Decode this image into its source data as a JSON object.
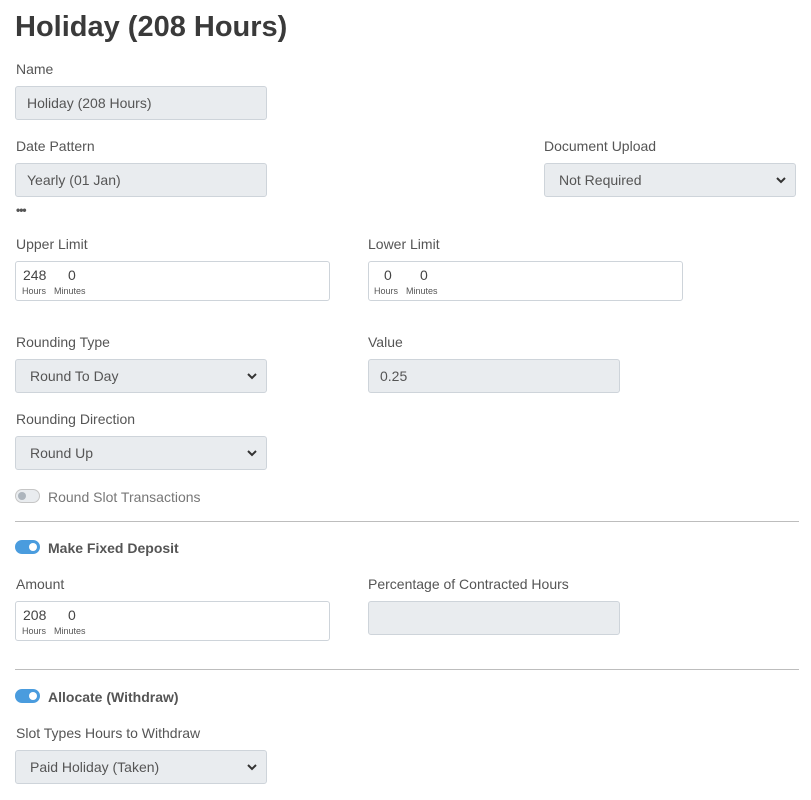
{
  "page": {
    "title": "Holiday (208 Hours)"
  },
  "name": {
    "label": "Name",
    "value": "Holiday (208 Hours)"
  },
  "date_pattern": {
    "label": "Date Pattern",
    "value": "Yearly (01 Jan)",
    "more": "•••"
  },
  "document_upload": {
    "label": "Document Upload",
    "selected": "Not Required"
  },
  "upper_limit": {
    "label": "Upper Limit",
    "hours": "248",
    "minutes": "0",
    "hours_unit": "Hours",
    "minutes_unit": "Minutes"
  },
  "lower_limit": {
    "label": "Lower Limit",
    "hours": "0",
    "minutes": "0",
    "hours_unit": "Hours",
    "minutes_unit": "Minutes"
  },
  "rounding_type": {
    "label": "Rounding Type",
    "selected": "Round To Day"
  },
  "value": {
    "label": "Value",
    "value": "0.25"
  },
  "rounding_direction": {
    "label": "Rounding Direction",
    "selected": "Round Up"
  },
  "round_slot": {
    "label": "Round Slot Transactions",
    "enabled": false
  },
  "fixed_deposit": {
    "label": "Make Fixed Deposit",
    "enabled": true
  },
  "amount": {
    "label": "Amount",
    "hours": "208",
    "minutes": "0",
    "hours_unit": "Hours",
    "minutes_unit": "Minutes"
  },
  "percentage": {
    "label": "Percentage of Contracted Hours",
    "value": ""
  },
  "allocate": {
    "label": "Allocate (Withdraw)",
    "enabled": true
  },
  "slot_types": {
    "label": "Slot Types Hours to Withdraw",
    "selected": "Paid Holiday (Taken)"
  },
  "colors": {
    "accent": "#4a9cde",
    "field_bg": "#e9ecef",
    "border": "#ced4da",
    "divider": "#bdbdbd"
  }
}
